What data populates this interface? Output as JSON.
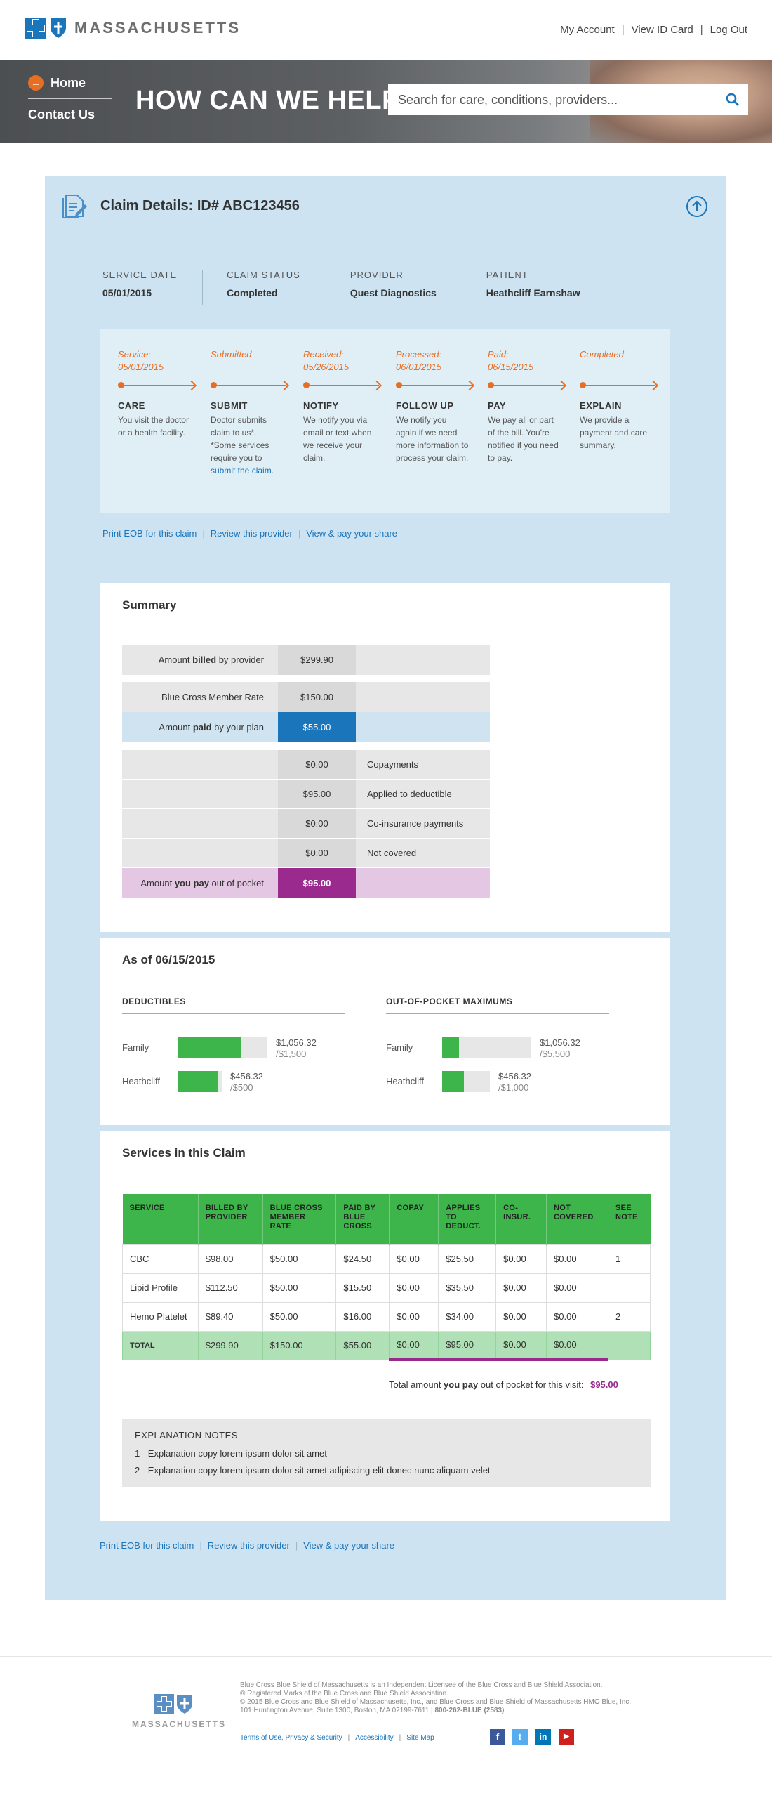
{
  "header": {
    "logo_text": "MASSACHUSETTS",
    "nav": [
      "My Account",
      "View ID Card",
      "Log Out"
    ]
  },
  "hero": {
    "home_label": "Home",
    "contact_label": "Contact Us",
    "title": "HOW CAN WE HELP?",
    "search_placeholder": "Search for care, conditions, providers..."
  },
  "claim": {
    "title": "Claim Details: ID# ABC123456",
    "info": [
      {
        "label": "SERVICE DATE",
        "value": "05/01/2015"
      },
      {
        "label": "CLAIM STATUS",
        "value": "Completed"
      },
      {
        "label": "PROVIDER",
        "value": "Quest Diagnostics"
      },
      {
        "label": "PATIENT",
        "value": "Heathcliff Earnshaw"
      }
    ],
    "timeline": [
      {
        "date1": "Service:",
        "date2": "05/01/2015",
        "title": "CARE",
        "desc": "You visit the doctor or a health facility."
      },
      {
        "date1": "Submitted",
        "date2": "",
        "title": "SUBMIT",
        "desc": "Doctor submits claim to us*. *Some services require you to",
        "link": "submit the claim."
      },
      {
        "date1": "Received:",
        "date2": "05/26/2015",
        "title": "NOTIFY",
        "desc": "We notify you via email or text when we receive your claim."
      },
      {
        "date1": "Processed:",
        "date2": "06/01/2015",
        "title": "FOLLOW UP",
        "desc": "We notify you again if we need more information to process your claim."
      },
      {
        "date1": "Paid:",
        "date2": "06/15/2015",
        "title": "PAY",
        "desc": "We pay all or part of the bill. You're notified if you need to pay."
      },
      {
        "date1": "Completed",
        "date2": "",
        "title": "EXPLAIN",
        "desc": "We provide a payment and care summary."
      }
    ],
    "links": [
      "Print EOB for this claim",
      "Review this provider",
      "View & pay your share"
    ]
  },
  "summary": {
    "title": "Summary",
    "billed": {
      "pre": "Amount ",
      "bold": "billed",
      "post": " by provider",
      "value": "$299.90"
    },
    "member_rate": {
      "label": "Blue Cross Member Rate",
      "value": "$150.00"
    },
    "paid": {
      "pre": "Amount ",
      "bold": "paid",
      "post": " by your plan",
      "value": "$55.00"
    },
    "breakdown": [
      {
        "value": "$0.00",
        "label": "Copayments"
      },
      {
        "value": "$95.00",
        "label": "Applied to deductible"
      },
      {
        "value": "$0.00",
        "label": "Co-insurance payments"
      },
      {
        "value": "$0.00",
        "label": "Not covered"
      }
    ],
    "you_pay": {
      "pre": "Amount ",
      "bold": "you pay",
      "post": " out of pocket",
      "value": "$95.00"
    }
  },
  "asof": {
    "title": "As of 06/15/2015",
    "deductibles": {
      "heading": "DEDUCTIBLES",
      "rows": [
        {
          "name": "Family",
          "amount": "$1,056.32",
          "limit": "/$1,500",
          "fraction": 0.704
        },
        {
          "name": "Heathcliff",
          "amount": "$456.32",
          "limit": "/$500",
          "fraction": 0.913
        }
      ]
    },
    "oop": {
      "heading": "OUT-OF-POCKET MAXIMUMS",
      "rows": [
        {
          "name": "Family",
          "amount": "$1,056.32",
          "limit": "/$5,500",
          "fraction": 0.192
        },
        {
          "name": "Heathcliff",
          "amount": "$456.32",
          "limit": "/$1,000",
          "fraction": 0.456
        }
      ]
    }
  },
  "services": {
    "title": "Services in this Claim",
    "columns": [
      "SERVICE",
      "BILLED BY PROVIDER",
      "BLUE CROSS MEMBER RATE",
      "PAID BY BLUE CROSS",
      "COPAY",
      "APPLIES TO DEDUCT.",
      "CO-INSUR.",
      "NOT COVERED",
      "SEE NOTE"
    ],
    "rows": [
      [
        "CBC",
        "$98.00",
        "$50.00",
        "$24.50",
        "$0.00",
        "$25.50",
        "$0.00",
        "$0.00",
        "1"
      ],
      [
        "Lipid Profile",
        "$112.50",
        "$50.00",
        "$15.50",
        "$0.00",
        "$35.50",
        "$0.00",
        "$0.00",
        ""
      ],
      [
        "Hemo Platelet",
        "$89.40",
        "$50.00",
        "$16.00",
        "$0.00",
        "$34.00",
        "$0.00",
        "$0.00",
        "2"
      ]
    ],
    "total": [
      "TOTAL",
      "$299.90",
      "$150.00",
      "$55.00",
      "$0.00",
      "$95.00",
      "$0.00",
      "$0.00",
      ""
    ],
    "total_pre": "Total amount ",
    "total_bold": "you pay",
    "total_post": " out of pocket for this visit:",
    "total_value": "$95.00",
    "notes_heading": "EXPLANATION NOTES",
    "notes": [
      "1 - Explanation copy lorem ipsum dolor sit amet",
      "2 - Explanation copy lorem ipsum dolor sit amet adipiscing elit donec nunc aliquam velet"
    ]
  },
  "footer": {
    "logo_text": "MASSACHUSETTS",
    "lines": [
      "Blue Cross Blue Shield of Massachusetts is an Independent Licensee of the Blue Cross and Blue Shield Association.",
      "® Registered Marks of the Blue Cross and Blue Shield Association.",
      "© 2015 Blue Cross and Blue Shield of Massachusetts, Inc., and Blue Cross and Blue Shield of Massachusetts HMO Blue, Inc.",
      "101 Huntington Avenue, Suite 1300, Boston, MA 02199-7611 |"
    ],
    "phone": "800-262-BLUE (2583)",
    "links": [
      "Terms of Use, Privacy & Security",
      "Accessibility",
      "Site Map"
    ],
    "social": [
      {
        "name": "facebook",
        "glyph": "f",
        "color": "#3b5998"
      },
      {
        "name": "twitter",
        "glyph": "t",
        "color": "#55acee"
      },
      {
        "name": "linkedin",
        "glyph": "in",
        "color": "#0077b5"
      },
      {
        "name": "youtube",
        "glyph": "▶",
        "color": "#cd201f"
      }
    ]
  }
}
